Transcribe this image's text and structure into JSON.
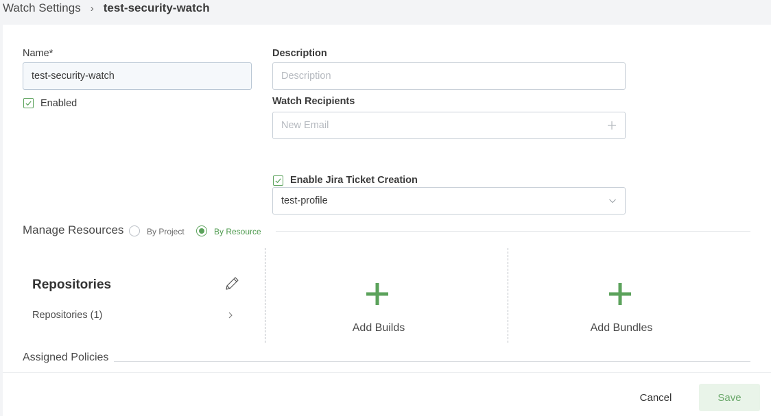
{
  "breadcrumb": {
    "parent": "Watch Settings",
    "separator": "›",
    "current": "test-security-watch"
  },
  "form": {
    "name_label": "Name*",
    "name_value": "test-security-watch",
    "enabled_label": "Enabled",
    "enabled_checked": true,
    "description_label": "Description",
    "description_placeholder": "Description",
    "recipients_label": "Watch Recipients",
    "recipients_placeholder": "New Email",
    "jira_label": "Enable Jira Ticket Creation",
    "jira_checked": true,
    "jira_profile_value": "test-profile"
  },
  "manage_resources": {
    "title": "Manage Resources",
    "options": [
      {
        "label": "By Project",
        "selected": false
      },
      {
        "label": "By Resource",
        "selected": true
      }
    ]
  },
  "resources": {
    "repositories_title": "Repositories",
    "repositories_item": "Repositories (1)",
    "add_builds_label": "Add Builds",
    "add_bundles_label": "Add Bundles"
  },
  "policies": {
    "title": "Assigned Policies"
  },
  "footer": {
    "cancel_label": "Cancel",
    "save_label": "Save"
  },
  "colors": {
    "accent_green": "#5ba25b",
    "save_bg": "#e9f4e9"
  },
  "icons": {
    "edit": "pencil-icon",
    "chevron_right": "chevron-right-icon",
    "plus": "plus-icon",
    "dropdown": "chevron-down-icon",
    "check": "checkmark-icon"
  }
}
